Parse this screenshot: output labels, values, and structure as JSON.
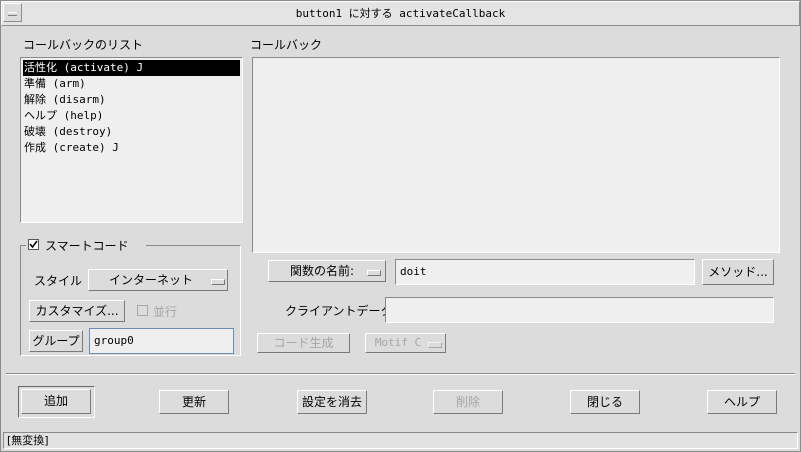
{
  "window": {
    "title": "button1 に対する activateCallback"
  },
  "callback_list": {
    "label": "コールバックのリスト",
    "items": [
      "活性化 (activate) J",
      "準備 (arm)",
      "解除 (disarm)",
      "ヘルプ (help)",
      "破壊 (destroy)",
      "作成 (create) J"
    ],
    "selected_index": 0
  },
  "callback": {
    "label": "コールバック"
  },
  "smart_code": {
    "label": "スマートコード",
    "checked": true,
    "style_label": "スタイル",
    "style_value": "インターネット",
    "customize_button": "カスタマイズ...",
    "parallel_label": "並行",
    "group_button": "グループ",
    "group_value": "group0"
  },
  "function": {
    "option_label": "関数の名前:",
    "name_value": "doit",
    "methods_button": "メソッド..."
  },
  "client_data": {
    "label": "クライアントデータ:",
    "value": ""
  },
  "code_gen": {
    "button": "コード生成",
    "option_value": "Motif C"
  },
  "actions": {
    "add": "追加",
    "update": "更新",
    "clear": "設定を消去",
    "delete": "削除",
    "close": "閉じる",
    "help": "ヘルプ"
  },
  "status_bar": {
    "text": "[無変換]"
  }
}
